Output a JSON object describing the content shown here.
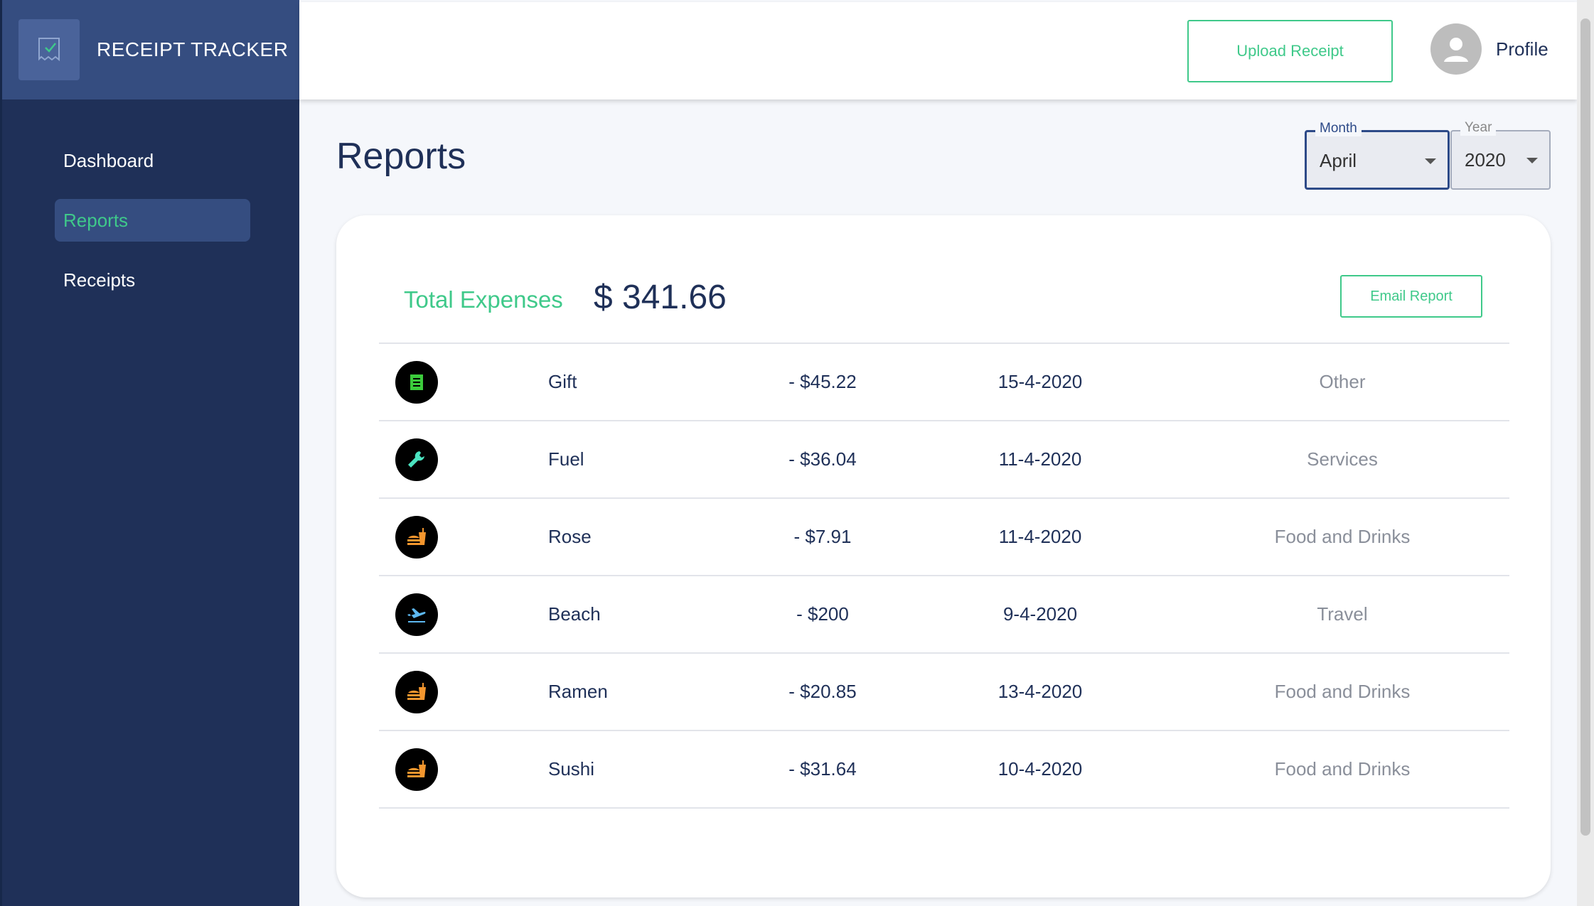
{
  "app": {
    "title": "RECEIPT TRACKER"
  },
  "sidebar": {
    "items": [
      {
        "label": "Dashboard",
        "active": false
      },
      {
        "label": "Reports",
        "active": true
      },
      {
        "label": "Receipts",
        "active": false
      }
    ]
  },
  "header": {
    "upload_label": "Upload Receipt",
    "profile_label": "Profile"
  },
  "page": {
    "title": "Reports"
  },
  "filters": {
    "month": {
      "legend": "Month",
      "value": "April"
    },
    "year": {
      "legend": "Year",
      "value": "2020"
    }
  },
  "summary": {
    "total_label": "Total Expenses",
    "total_value": "$ 341.66",
    "email_label": "Email Report"
  },
  "receipts": [
    {
      "icon": "receipt-icon",
      "icon_color": "#3ccb3c",
      "name": "Gift",
      "amount": "- $45.22",
      "date": "15-4-2020",
      "category": "Other"
    },
    {
      "icon": "wrench-icon",
      "icon_color": "#4be3c0",
      "name": "Fuel",
      "amount": "- $36.04",
      "date": "11-4-2020",
      "category": "Services"
    },
    {
      "icon": "food-icon",
      "icon_color": "#f3962e",
      "name": "Rose",
      "amount": "- $7.91",
      "date": "11-4-2020",
      "category": "Food and Drinks"
    },
    {
      "icon": "flight-icon",
      "icon_color": "#5db8f0",
      "name": "Beach",
      "amount": "- $200",
      "date": "9-4-2020",
      "category": "Travel"
    },
    {
      "icon": "food-icon",
      "icon_color": "#f3962e",
      "name": "Ramen",
      "amount": "- $20.85",
      "date": "13-4-2020",
      "category": "Food and Drinks"
    },
    {
      "icon": "food-icon",
      "icon_color": "#f3962e",
      "name": "Sushi",
      "amount": "- $31.64",
      "date": "10-4-2020",
      "category": "Food and Drinks"
    }
  ],
  "colors": {
    "sidebar": "#1f3058",
    "brand_bar": "#354d80",
    "accent": "#3fc98a",
    "text_dark": "#1f3058"
  }
}
